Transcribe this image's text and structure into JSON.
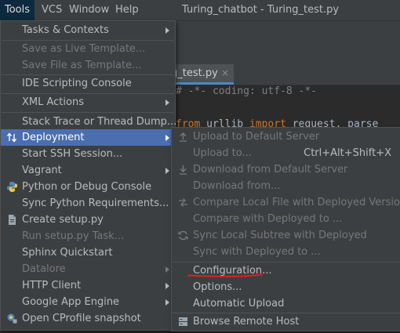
{
  "menubar": {
    "items": [
      "Tools",
      "VCS",
      "Window",
      "Help"
    ],
    "title": "Turing_chatbot - Turing_test.py"
  },
  "editor": {
    "tab_label": "g_test.py",
    "tab_close": "×",
    "code_line1": "# -*- coding: utf-8 -*-",
    "code_line2_kw1": "from",
    "code_line2_mid": " urllib ",
    "code_line2_kw2": "import",
    "code_line2_end": " request, parse"
  },
  "tools_menu": {
    "items": [
      {
        "label": "Tasks & Contexts",
        "enabled": true,
        "submenu": true
      },
      {
        "label": "Save as Live Template...",
        "enabled": false
      },
      {
        "label": "Save File as Template...",
        "enabled": false
      },
      {
        "label": "IDE Scripting Console",
        "enabled": true
      },
      {
        "label": "XML Actions",
        "enabled": true,
        "submenu": true
      },
      {
        "label": "Stack Trace or Thread Dump...",
        "enabled": true
      },
      {
        "label": "Deployment",
        "enabled": true,
        "submenu": true,
        "selected": true,
        "icon": "deployment-icon"
      },
      {
        "label": "Start SSH Session...",
        "enabled": true
      },
      {
        "label": "Vagrant",
        "enabled": true,
        "submenu": true
      },
      {
        "label": "Python or Debug Console",
        "enabled": true,
        "icon": "python-icon"
      },
      {
        "label": "Sync Python Requirements...",
        "enabled": true
      },
      {
        "label": "Create setup.py",
        "enabled": true,
        "icon": "setup-file-icon"
      },
      {
        "label": "Run setup.py Task...",
        "enabled": false
      },
      {
        "label": "Sphinx Quickstart",
        "enabled": true
      },
      {
        "label": "Datalore",
        "enabled": false,
        "submenu": true
      },
      {
        "label": "HTTP Client",
        "enabled": true,
        "submenu": true
      },
      {
        "label": "Google App Engine",
        "enabled": true,
        "submenu": true
      },
      {
        "label": "Open CProfile snapshot",
        "enabled": true,
        "icon": "profiler-icon"
      }
    ]
  },
  "deployment_menu": {
    "items": [
      {
        "label": "Upload to Default Server",
        "enabled": false,
        "icon": "upload-icon"
      },
      {
        "label": "Upload to...",
        "enabled": false,
        "shortcut": "Ctrl+Alt+Shift+X"
      },
      {
        "label": "Download from Default Server",
        "enabled": false,
        "icon": "download-icon"
      },
      {
        "label": "Download from...",
        "enabled": false
      },
      {
        "label": "Compare Local File with Deployed Version",
        "enabled": false,
        "icon": "compare-icon"
      },
      {
        "label": "Compare with Deployed to ...",
        "enabled": false
      },
      {
        "label": "Sync Local Subtree with Deployed",
        "enabled": false,
        "icon": "sync-icon"
      },
      {
        "label": "Sync with Deployed to ...",
        "enabled": false
      },
      {
        "label": "Configuration...",
        "enabled": true
      },
      {
        "label": "Options...",
        "enabled": true
      },
      {
        "label": "Automatic Upload",
        "enabled": true
      },
      {
        "label": "Browse Remote Host",
        "enabled": true,
        "icon": "remote-host-icon"
      }
    ]
  },
  "colors": {
    "menu_bg": "#3c3f41",
    "selection": "#4b6eaf",
    "annotation_underline": "#e0201b"
  }
}
